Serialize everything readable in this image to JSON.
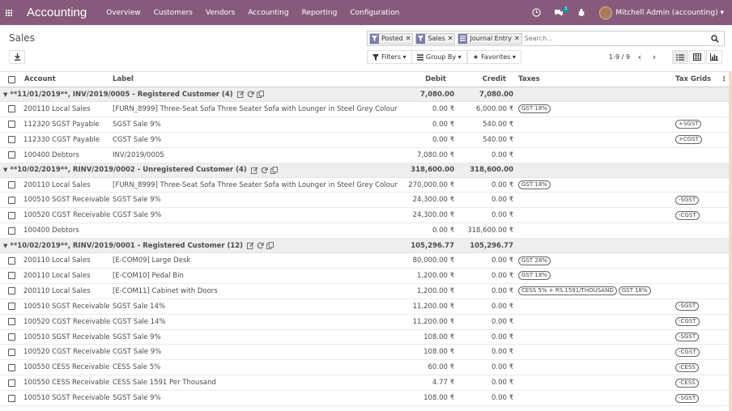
{
  "navbar": {
    "brand": "Accounting",
    "menu": [
      "Overview",
      "Customers",
      "Vendors",
      "Accounting",
      "Reporting",
      "Configuration"
    ],
    "chat_count": "3",
    "user_name": "Mitchell Admin (accounting)"
  },
  "control_panel": {
    "breadcrumb": "Sales",
    "facets": [
      "Posted",
      "Sales",
      "Journal Entry"
    ],
    "search_placeholder": "Search...",
    "filters_label": "Filters",
    "groupby_label": "Group By",
    "favorites_label": "Favorites",
    "pager": "1-9 / 9"
  },
  "table": {
    "headers": {
      "account": "Account",
      "label": "Label",
      "debit": "Debit",
      "credit": "Credit",
      "taxes": "Taxes",
      "tax_grids": "Tax Grids"
    },
    "groups": [
      {
        "title": "**11/01/2019**, INV/2019/0005 - Registered Customer (4)",
        "debit": "7,080.00",
        "credit": "7,080.00",
        "rows": [
          {
            "account": "200110 Local Sales",
            "label": "[FURN_8999] Three-Seat Sofa Three Seater Sofa with Lounger in Steel Grey Colour",
            "debit": "0.00 ₹",
            "credit": "6,000.00 ₹",
            "taxes": [
              "GST 18%"
            ],
            "grids": []
          },
          {
            "account": "112320 SGST Payable",
            "label": "SGST Sale 9%",
            "debit": "0.00 ₹",
            "credit": "540.00 ₹",
            "taxes": [],
            "grids": [
              "+SGST"
            ]
          },
          {
            "account": "112330 CGST Payable",
            "label": "CGST Sale 9%",
            "debit": "0.00 ₹",
            "credit": "540.00 ₹",
            "taxes": [],
            "grids": [
              "+CGST"
            ]
          },
          {
            "account": "100400 Debtors",
            "label": "INV/2019/0005",
            "debit": "7,080.00 ₹",
            "credit": "0.00 ₹",
            "taxes": [],
            "grids": []
          }
        ]
      },
      {
        "title": "**10/02/2019**, RINV/2019/0002 - Unregistered Customer (4)",
        "debit": "318,600.00",
        "credit": "318,600.00",
        "rows": [
          {
            "account": "200110 Local Sales",
            "label": "[FURN_8999] Three-Seat Sofa Three Seater Sofa with Lounger in Steel Grey Colour",
            "debit": "270,000.00 ₹",
            "credit": "0.00 ₹",
            "taxes": [
              "GST 18%"
            ],
            "grids": []
          },
          {
            "account": "100510 SGST Receivable",
            "label": "SGST Sale 9%",
            "debit": "24,300.00 ₹",
            "credit": "0.00 ₹",
            "taxes": [],
            "grids": [
              "-SGST"
            ]
          },
          {
            "account": "100520 CGST Receivable",
            "label": "CGST Sale 9%",
            "debit": "24,300.00 ₹",
            "credit": "0.00 ₹",
            "taxes": [],
            "grids": [
              "-CGST"
            ]
          },
          {
            "account": "100400 Debtors",
            "label": "",
            "debit": "0.00 ₹",
            "credit": "318,600.00 ₹",
            "taxes": [],
            "grids": []
          }
        ]
      },
      {
        "title": "**10/02/2019**, RINV/2019/0001 - Registered Customer (12)",
        "debit": "105,296.77",
        "credit": "105,296.77",
        "rows": [
          {
            "account": "200110 Local Sales",
            "label": "[E-COM09] Large Desk",
            "debit": "80,000.00 ₹",
            "credit": "0.00 ₹",
            "taxes": [
              "GST 28%"
            ],
            "grids": []
          },
          {
            "account": "200110 Local Sales",
            "label": "[E-COM10] Pedal Bin",
            "debit": "1,200.00 ₹",
            "credit": "0.00 ₹",
            "taxes": [
              "GST 18%"
            ],
            "grids": []
          },
          {
            "account": "200110 Local Sales",
            "label": "[E-COM11] Cabinet with Doors",
            "debit": "1,200.00 ₹",
            "credit": "0.00 ₹",
            "taxes": [
              "CESS 5% + RS.1591/THOUSAND",
              "GST 18%"
            ],
            "grids": []
          },
          {
            "account": "100510 SGST Receivable",
            "label": "SGST Sale 14%",
            "debit": "11,200.00 ₹",
            "credit": "0.00 ₹",
            "taxes": [],
            "grids": [
              "-SGST"
            ]
          },
          {
            "account": "100520 CGST Receivable",
            "label": "CGST Sale 14%",
            "debit": "11,200.00 ₹",
            "credit": "0.00 ₹",
            "taxes": [],
            "grids": [
              "-CGST"
            ]
          },
          {
            "account": "100510 SGST Receivable",
            "label": "SGST Sale 9%",
            "debit": "108.00 ₹",
            "credit": "0.00 ₹",
            "taxes": [],
            "grids": [
              "-SGST"
            ]
          },
          {
            "account": "100520 CGST Receivable",
            "label": "CGST Sale 9%",
            "debit": "108.00 ₹",
            "credit": "0.00 ₹",
            "taxes": [],
            "grids": [
              "-CGST"
            ]
          },
          {
            "account": "100550 CESS Receivable",
            "label": "CESS Sale 5%",
            "debit": "60.00 ₹",
            "credit": "0.00 ₹",
            "taxes": [],
            "grids": [
              "-CESS"
            ]
          },
          {
            "account": "100550 CESS Receivable",
            "label": "CESS Sale 1591 Per Thousand",
            "debit": "4.77 ₹",
            "credit": "0.00 ₹",
            "taxes": [],
            "grids": [
              "-CESS"
            ]
          },
          {
            "account": "100510 SGST Receivable",
            "label": "SGST Sale 9%",
            "debit": "108.00 ₹",
            "credit": "0.00 ₹",
            "taxes": [],
            "grids": [
              "-SGST"
            ]
          }
        ]
      }
    ]
  }
}
